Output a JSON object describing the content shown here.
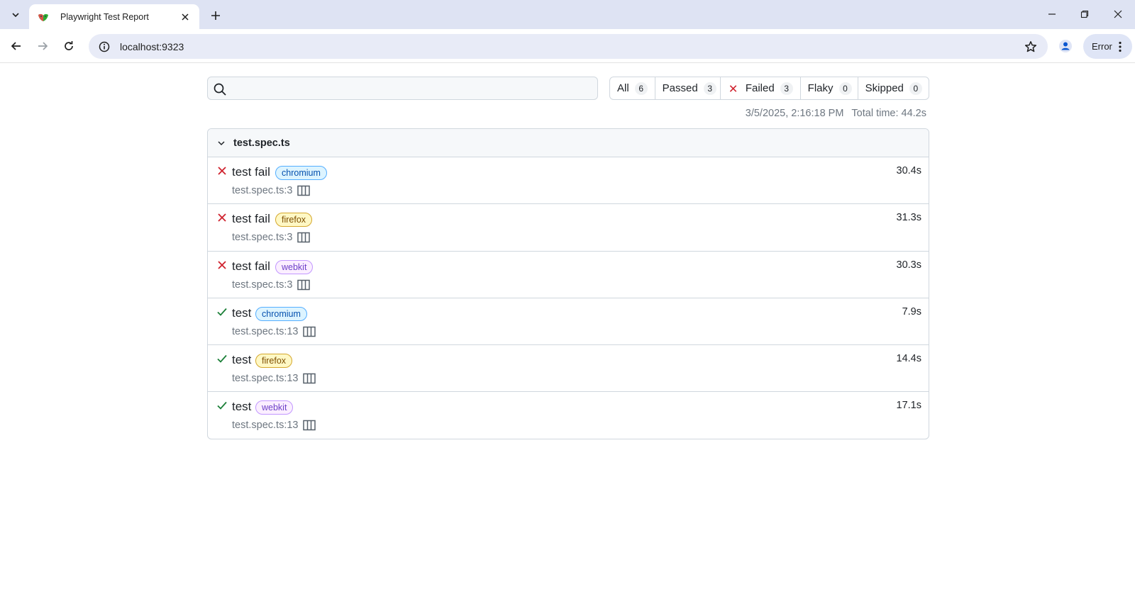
{
  "browser": {
    "tab_title": "Playwright Test Report",
    "url": "localhost:9323",
    "profile_status": "Error"
  },
  "report": {
    "search": {
      "value": "",
      "placeholder": ""
    },
    "filters": [
      {
        "label": "All",
        "count": "6"
      },
      {
        "label": "Passed",
        "count": "3"
      },
      {
        "label": "Failed",
        "count": "3"
      },
      {
        "label": "Flaky",
        "count": "0"
      },
      {
        "label": "Skipped",
        "count": "0"
      }
    ],
    "timestamp": "3/5/2025, 2:16:18 PM",
    "total_time": "Total time: 44.2s",
    "file": {
      "name": "test.spec.ts",
      "tests": [
        {
          "status": "failed",
          "title": "test fail",
          "project": "chromium",
          "location": "test.spec.ts:3",
          "duration": "30.4s"
        },
        {
          "status": "failed",
          "title": "test fail",
          "project": "firefox",
          "location": "test.spec.ts:3",
          "duration": "31.3s"
        },
        {
          "status": "failed",
          "title": "test fail",
          "project": "webkit",
          "location": "test.spec.ts:3",
          "duration": "30.3s"
        },
        {
          "status": "passed",
          "title": "test",
          "project": "chromium",
          "location": "test.spec.ts:13",
          "duration": "7.9s"
        },
        {
          "status": "passed",
          "title": "test",
          "project": "firefox",
          "location": "test.spec.ts:13",
          "duration": "14.4s"
        },
        {
          "status": "passed",
          "title": "test",
          "project": "webkit",
          "location": "test.spec.ts:13",
          "duration": "17.1s"
        }
      ]
    }
  },
  "colors": {
    "failed": "#cf222e",
    "passed": "#1a7f37",
    "chromium": "#0550ae",
    "firefox": "#7d4e00",
    "webkit": "#6e40c9"
  },
  "icons": {
    "status_failed": "close-x-icon",
    "status_passed": "check-icon",
    "trace": "trace-viewer-icon"
  }
}
